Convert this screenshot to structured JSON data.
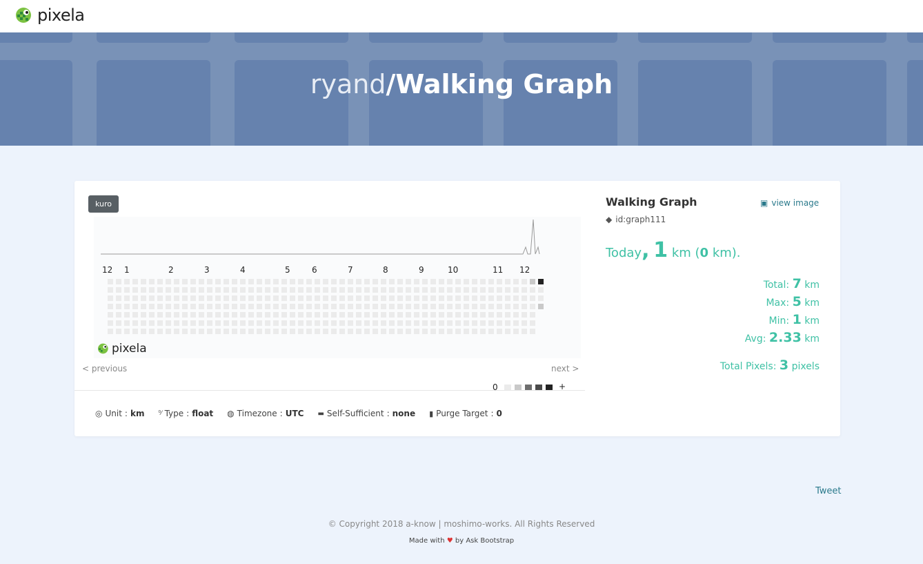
{
  "nav": {
    "brand": "pixela"
  },
  "hero": {
    "user": "ryand",
    "separator": "/",
    "graph_name": "Walking Graph"
  },
  "graph": {
    "theme_badge": "kuro",
    "months": [
      "12",
      "1",
      "2",
      "3",
      "4",
      "5",
      "6",
      "7",
      "8",
      "9",
      "10",
      "11",
      "12"
    ],
    "legend_min": "0",
    "legend_max": "+",
    "watermark": "pixela",
    "colors": {
      "empty": "#ebebeb",
      "level1": "#c9c9c9",
      "level2": "#8a8a8a",
      "level3": "#4e4e4e",
      "level4": "#222222"
    },
    "prev_label": "< previous",
    "next_label": "next >"
  },
  "meta": {
    "unit_label": "Unit",
    "unit_value": "km",
    "type_label": "Type",
    "type_value": "float",
    "timezone_label": "Timezone",
    "timezone_value": "UTC",
    "self_label": "Self-Sufficient",
    "self_value": "none",
    "purge_label": "Purge Target",
    "purge_value": "0",
    "colon": ":"
  },
  "summary": {
    "name": "Walking Graph",
    "view_image": "view image",
    "id": "id:graph111",
    "today_label": "Today",
    "today_comma": ",",
    "today_value": "1",
    "today_unit": "km",
    "today_prev_open": "(",
    "today_prev_value": "0",
    "today_prev_close": "km).",
    "total_label": "Total:",
    "total_value": "7",
    "max_label": "Max:",
    "max_value": "5",
    "min_label": "Min:",
    "min_value": "1",
    "avg_label": "Avg:",
    "avg_value": "2.33",
    "unit": "km",
    "pixels_label": "Total Pixels:",
    "pixels_value": "3",
    "pixels_unit": "pixels"
  },
  "footer": {
    "tweet": "Tweet",
    "copyright": "© Copyright 2018 a-know | moshimo-works. All Rights Reserved",
    "made_prefix": "Made with",
    "heart": "♥",
    "made_suffix": "by Ask Bootstrap"
  }
}
